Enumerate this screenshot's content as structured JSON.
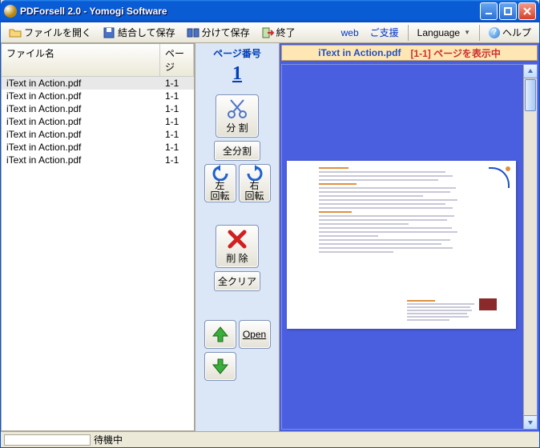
{
  "window": {
    "title": "PDForsell 2.0 - Yomogi Software"
  },
  "toolbar": {
    "open": "ファイルを開く",
    "merge_save": "結合して保存",
    "split_save": "分けて保存",
    "exit": "終了",
    "web": "web",
    "support": "ご支援",
    "language": "Language",
    "help": "ヘルプ"
  },
  "filelist": {
    "col_name": "ファイル名",
    "col_page": "ページ",
    "rows": [
      {
        "name": "iText in Action.pdf",
        "page": "1-1"
      },
      {
        "name": "iText in Action.pdf",
        "page": "1-1"
      },
      {
        "name": "iText in Action.pdf",
        "page": "1-1"
      },
      {
        "name": "iText in Action.pdf",
        "page": "1-1"
      },
      {
        "name": "iText in Action.pdf",
        "page": "1-1"
      },
      {
        "name": "iText in Action.pdf",
        "page": "1-1"
      },
      {
        "name": "iText in Action.pdf",
        "page": "1-1"
      }
    ]
  },
  "mid": {
    "pagenum_label": "ページ番号",
    "pagenum": "1",
    "split": "分 割",
    "split_all": "全分割",
    "rot_left": "左\n回転",
    "rot_right": "右\n回転",
    "delete": "削 除",
    "clear_all": "全クリア",
    "open": "Open"
  },
  "preview": {
    "filename": "iText in Action.pdf",
    "range": "[1-1]",
    "message": "ページを表示中"
  },
  "status": {
    "text": "待機中"
  }
}
